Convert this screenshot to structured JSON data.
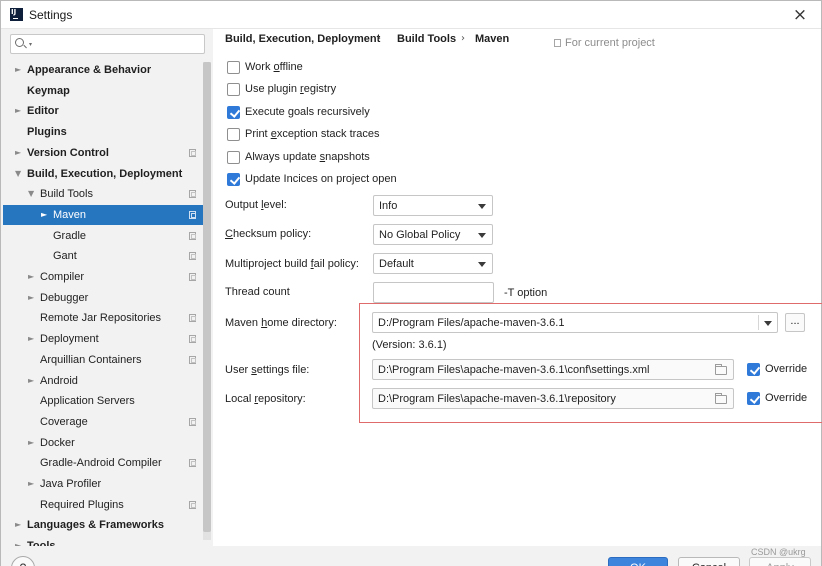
{
  "window": {
    "title": "Settings",
    "close_glyph": "×"
  },
  "search": {
    "placeholder": "",
    "caret": "▾"
  },
  "tree": [
    {
      "label": "Appearance & Behavior",
      "arrow": "►",
      "bold": true
    },
    {
      "label": "Keymap",
      "arrow": "",
      "bold": true
    },
    {
      "label": "Editor",
      "arrow": "►",
      "bold": true
    },
    {
      "label": "Plugins",
      "arrow": "",
      "bold": true
    },
    {
      "label": "Version Control",
      "arrow": "►",
      "bold": true,
      "project": true
    },
    {
      "label": "Build, Execution, Deployment",
      "arrow": "▼",
      "bold": true
    },
    {
      "label": "Build Tools",
      "arrow": "▼",
      "project": true
    },
    {
      "label": "Maven",
      "arrow": "►",
      "project": true,
      "selected": true
    },
    {
      "label": "Gradle",
      "arrow": "",
      "project": true
    },
    {
      "label": "Gant",
      "arrow": "",
      "project": true
    },
    {
      "label": "Compiler",
      "arrow": "►",
      "project": true
    },
    {
      "label": "Debugger",
      "arrow": "►"
    },
    {
      "label": "Remote Jar Repositories",
      "arrow": "",
      "project": true
    },
    {
      "label": "Deployment",
      "arrow": "►",
      "project": true
    },
    {
      "label": "Arquillian Containers",
      "arrow": "",
      "project": true
    },
    {
      "label": "Android",
      "arrow": "►"
    },
    {
      "label": "Application Servers",
      "arrow": ""
    },
    {
      "label": "Coverage",
      "arrow": "",
      "project": true
    },
    {
      "label": "Docker",
      "arrow": "►"
    },
    {
      "label": "Gradle-Android Compiler",
      "arrow": "",
      "project": true
    },
    {
      "label": "Java Profiler",
      "arrow": "►"
    },
    {
      "label": "Required Plugins",
      "arrow": "",
      "project": true
    },
    {
      "label": "Languages & Frameworks",
      "arrow": "►",
      "bold": true
    },
    {
      "label": "Tools",
      "arrow": "►",
      "bold": true
    }
  ],
  "breadcrumb": {
    "items": [
      "Build, Execution, Deployment",
      "Build Tools",
      "Maven"
    ],
    "separator": "›",
    "scope_note": "For current project"
  },
  "options": {
    "work_offline": {
      "pre": "Work ",
      "u": "o",
      "post": "ffline",
      "checked": false
    },
    "use_plugin_registry": {
      "pre": "Use plugin ",
      "u": "r",
      "post": "egistry",
      "checked": false
    },
    "execute_goals_recursively": {
      "pre": "Execute ",
      "u": "g",
      "post": "oals recursively",
      "checked": true
    },
    "print_exception_stack_traces": {
      "pre": "Print ",
      "u": "e",
      "post": "xception stack traces",
      "checked": false
    },
    "always_update_snapshots": {
      "pre": "Always update ",
      "u": "s",
      "post": "napshots",
      "checked": false
    },
    "update_indices": {
      "pre": "Update Incices on project open",
      "u": "",
      "post": "",
      "checked": true
    }
  },
  "fields": {
    "output_level": {
      "pre": "Output ",
      "u": "l",
      "post": "evel:",
      "value": "Info"
    },
    "checksum_policy": {
      "pre": "",
      "u": "C",
      "post": "hecksum policy:",
      "value": "No Global Policy"
    },
    "multiproject_fail_policy": {
      "pre": "Multiproject build ",
      "u": "f",
      "post": "ail policy:",
      "value": "Default"
    },
    "thread_count": {
      "label": "Thread count",
      "value": "",
      "suffix": "-T option"
    },
    "maven_home": {
      "pre": "Maven ",
      "u": "h",
      "post": "ome directory:",
      "value": "D:/Program Files/apache-maven-3.6.1",
      "version": "(Version: 3.6.1)",
      "browse": "..."
    },
    "user_settings": {
      "pre": "User ",
      "u": "s",
      "post": "ettings file:",
      "value": "D:\\Program Files\\apache-maven-3.6.1\\conf\\settings.xml",
      "override_label": "Override",
      "override": true
    },
    "local_repo": {
      "pre": "Local ",
      "u": "r",
      "post": "epository:",
      "value": "D:\\Program Files\\apache-maven-3.6.1\\repository",
      "override_label": "Override",
      "override": true
    }
  },
  "buttons": {
    "help": "?",
    "ok": "OK",
    "cancel": "Cancel",
    "apply": "Apply"
  },
  "watermark": "CSDN @ukrg",
  "colors": {
    "selection": "#2675bf",
    "highlight_frame": "#e06b6b",
    "checkbox_checked": "#2f7ad9",
    "ok_button": "#3d84dc"
  }
}
